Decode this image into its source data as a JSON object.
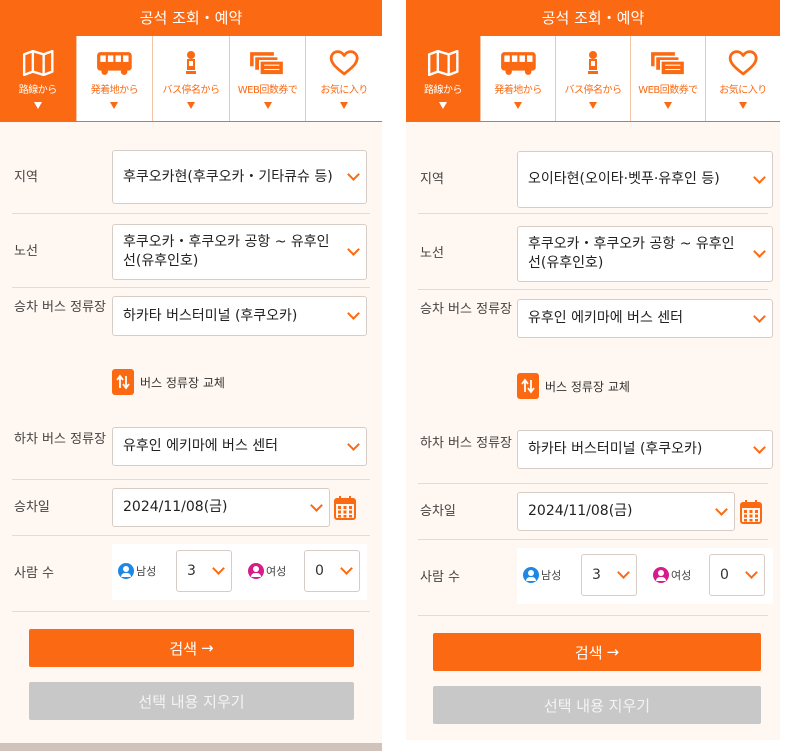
{
  "header": {
    "title": "공석 조회・예약"
  },
  "tabs": [
    {
      "id": "route",
      "label": "路線から",
      "icon": "map-icon"
    },
    {
      "id": "origin",
      "label": "発着地から",
      "icon": "bus-icon"
    },
    {
      "id": "stop",
      "label": "バス停名から",
      "icon": "bus-stop-icon"
    },
    {
      "id": "web",
      "label": "WEB回数券で",
      "icon": "ticket-icon"
    },
    {
      "id": "fav",
      "label": "お気に入り",
      "icon": "heart-icon"
    }
  ],
  "labels": {
    "region": "지역",
    "route": "노선",
    "board_stop": "승차 버스 정류장",
    "alight_stop": "하차 버스 정류장",
    "date": "승차일",
    "people": "사람 수",
    "male": "남성",
    "female": "여성",
    "swap": "버스 정류장 교체",
    "search": "검색",
    "clear": "선택 내용 지우기"
  },
  "colors": {
    "accent": "#fb6a12",
    "male": "#1e88e5",
    "female": "#d81b8a"
  },
  "left": {
    "region": "후쿠오카현(후쿠오카・기타큐슈 등)",
    "route": "후쿠오카・후쿠오카 공항 ~ 유후인선(유후인호)",
    "board_stop": "하카타 버스터미널 (후쿠오카)",
    "alight_stop": "유후인 에키마에 버스 센터",
    "date": "2024/11/08(금)",
    "male_count": "3",
    "female_count": "0"
  },
  "right": {
    "region": "오이타현(오이타·벳푸·유후인 등)",
    "route": "후쿠오카・후쿠오카 공항 ~ 유후인선(유후인호)",
    "board_stop": "유후인 에키마에 버스 센터",
    "alight_stop": "하카타 버스터미널 (후쿠오카)",
    "date": "2024/11/08(금)",
    "male_count": "3",
    "female_count": "0"
  }
}
